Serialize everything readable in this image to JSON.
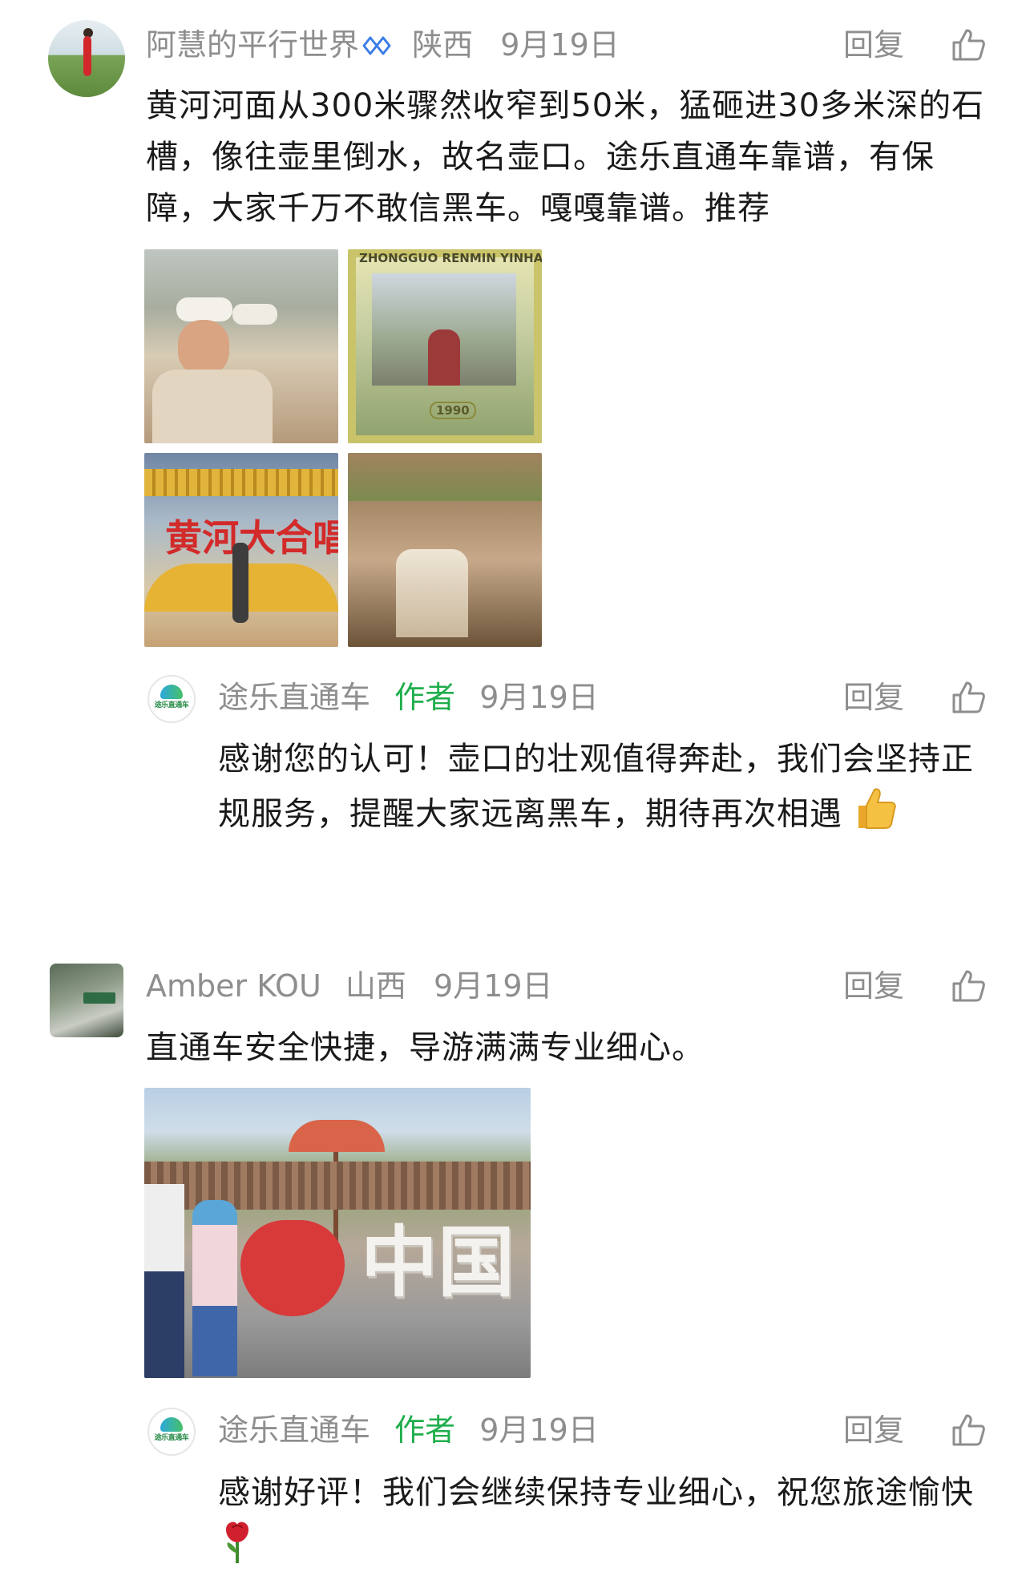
{
  "comments": [
    {
      "user": "阿慧的平行世界",
      "location": "陕西",
      "date": "9月19日",
      "text": "黄河河面从300米骤然收窄到50米，猛砸进30多米深的石槽，像往壶里倒水，故名壶口。途乐直通车靠谱，有保障，大家千万不敢信黑车。嘎嘎靠谱。推荐",
      "photo_labels": {
        "banknote_top": "ZHONGGUO RENMIN YINHANG",
        "banknote_year": "1990",
        "sign": "黄河大合唱"
      },
      "reply": {
        "user": "途乐直通车",
        "badge": "作者",
        "date": "9月19日",
        "text": "感谢您的认可！壶口的壮观值得奔赴，我们会坚持正规服务，提醒大家远离黑车，期待再次相遇",
        "emoji": "thumbs-up"
      }
    },
    {
      "user": "Amber KOU",
      "location": "山西",
      "date": "9月19日",
      "text": "直通车安全快捷，导游满满专业细心。",
      "photo_labels": {
        "sculpture": "中国"
      },
      "reply": {
        "user": "途乐直通车",
        "badge": "作者",
        "date": "9月19日",
        "text": "感谢好评！我们会继续保持专业细心，祝您旅途愉快",
        "emoji": "rose"
      }
    }
  ],
  "ui": {
    "reply_label": "回复",
    "brand_logo_text": "途乐直通车"
  },
  "colors": {
    "meta": "#8e8e8e",
    "author_badge": "#1fae4c",
    "verify": "#3b7de8"
  }
}
